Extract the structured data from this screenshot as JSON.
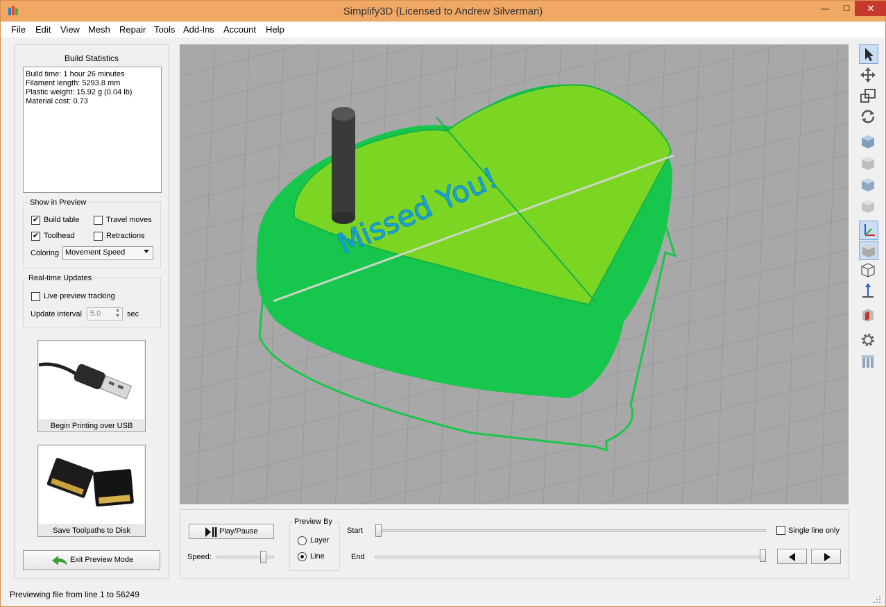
{
  "window": {
    "title": "Simplify3D (Licensed to Andrew Silverman)",
    "minimize": "—",
    "maximize": "☐",
    "close": "✕"
  },
  "menu": [
    "File",
    "Edit",
    "View",
    "Mesh",
    "Repair",
    "Tools",
    "Add-Ins",
    "Account",
    "Help"
  ],
  "build_statistics": {
    "title": "Build Statistics",
    "lines": [
      "Build time: 1 hour 26 minutes",
      "Filament length: 5293.8 mm",
      "Plastic weight: 15.92 g (0.04 lb)",
      "Material cost: 0.73"
    ]
  },
  "show_in_preview": {
    "title": "Show in Preview",
    "build_table": {
      "label": "Build table",
      "checked": true
    },
    "travel_moves": {
      "label": "Travel moves",
      "checked": false
    },
    "toolhead": {
      "label": "Toolhead",
      "checked": true
    },
    "retractions": {
      "label": "Retractions",
      "checked": false
    },
    "coloring_label": "Coloring",
    "coloring_value": "Movement Speed"
  },
  "realtime_updates": {
    "title": "Real-time Updates",
    "live_tracking": {
      "label": "Live preview tracking",
      "checked": false
    },
    "interval_label": "Update interval",
    "interval_value": "5.0",
    "interval_unit": "sec"
  },
  "buttons": {
    "usb": "Begin Printing over USB",
    "disk": "Save Toolpaths to Disk",
    "exit_preview": "Exit Preview Mode",
    "play_pause": "Play/Pause"
  },
  "viewport": {
    "text": "Missed You!",
    "colors": {
      "plate": "#a8a8a8",
      "toolpath": "#19d44a",
      "top": "#7ddc2a",
      "text": "#1aa6d8",
      "toolhead": "#3a3a3a"
    }
  },
  "playback": {
    "speed_label": "Speed:",
    "speed_level": 0.85,
    "preview_by_title": "Preview By",
    "layer_label": "Layer",
    "line_label": "Line",
    "selected": "Line",
    "start_label": "Start",
    "end_label": "End",
    "start_position": 0.0,
    "end_position": 1.0,
    "single_line": {
      "label": "Single line only",
      "checked": false
    }
  },
  "status": "Previewing file from line 1 to 56249"
}
